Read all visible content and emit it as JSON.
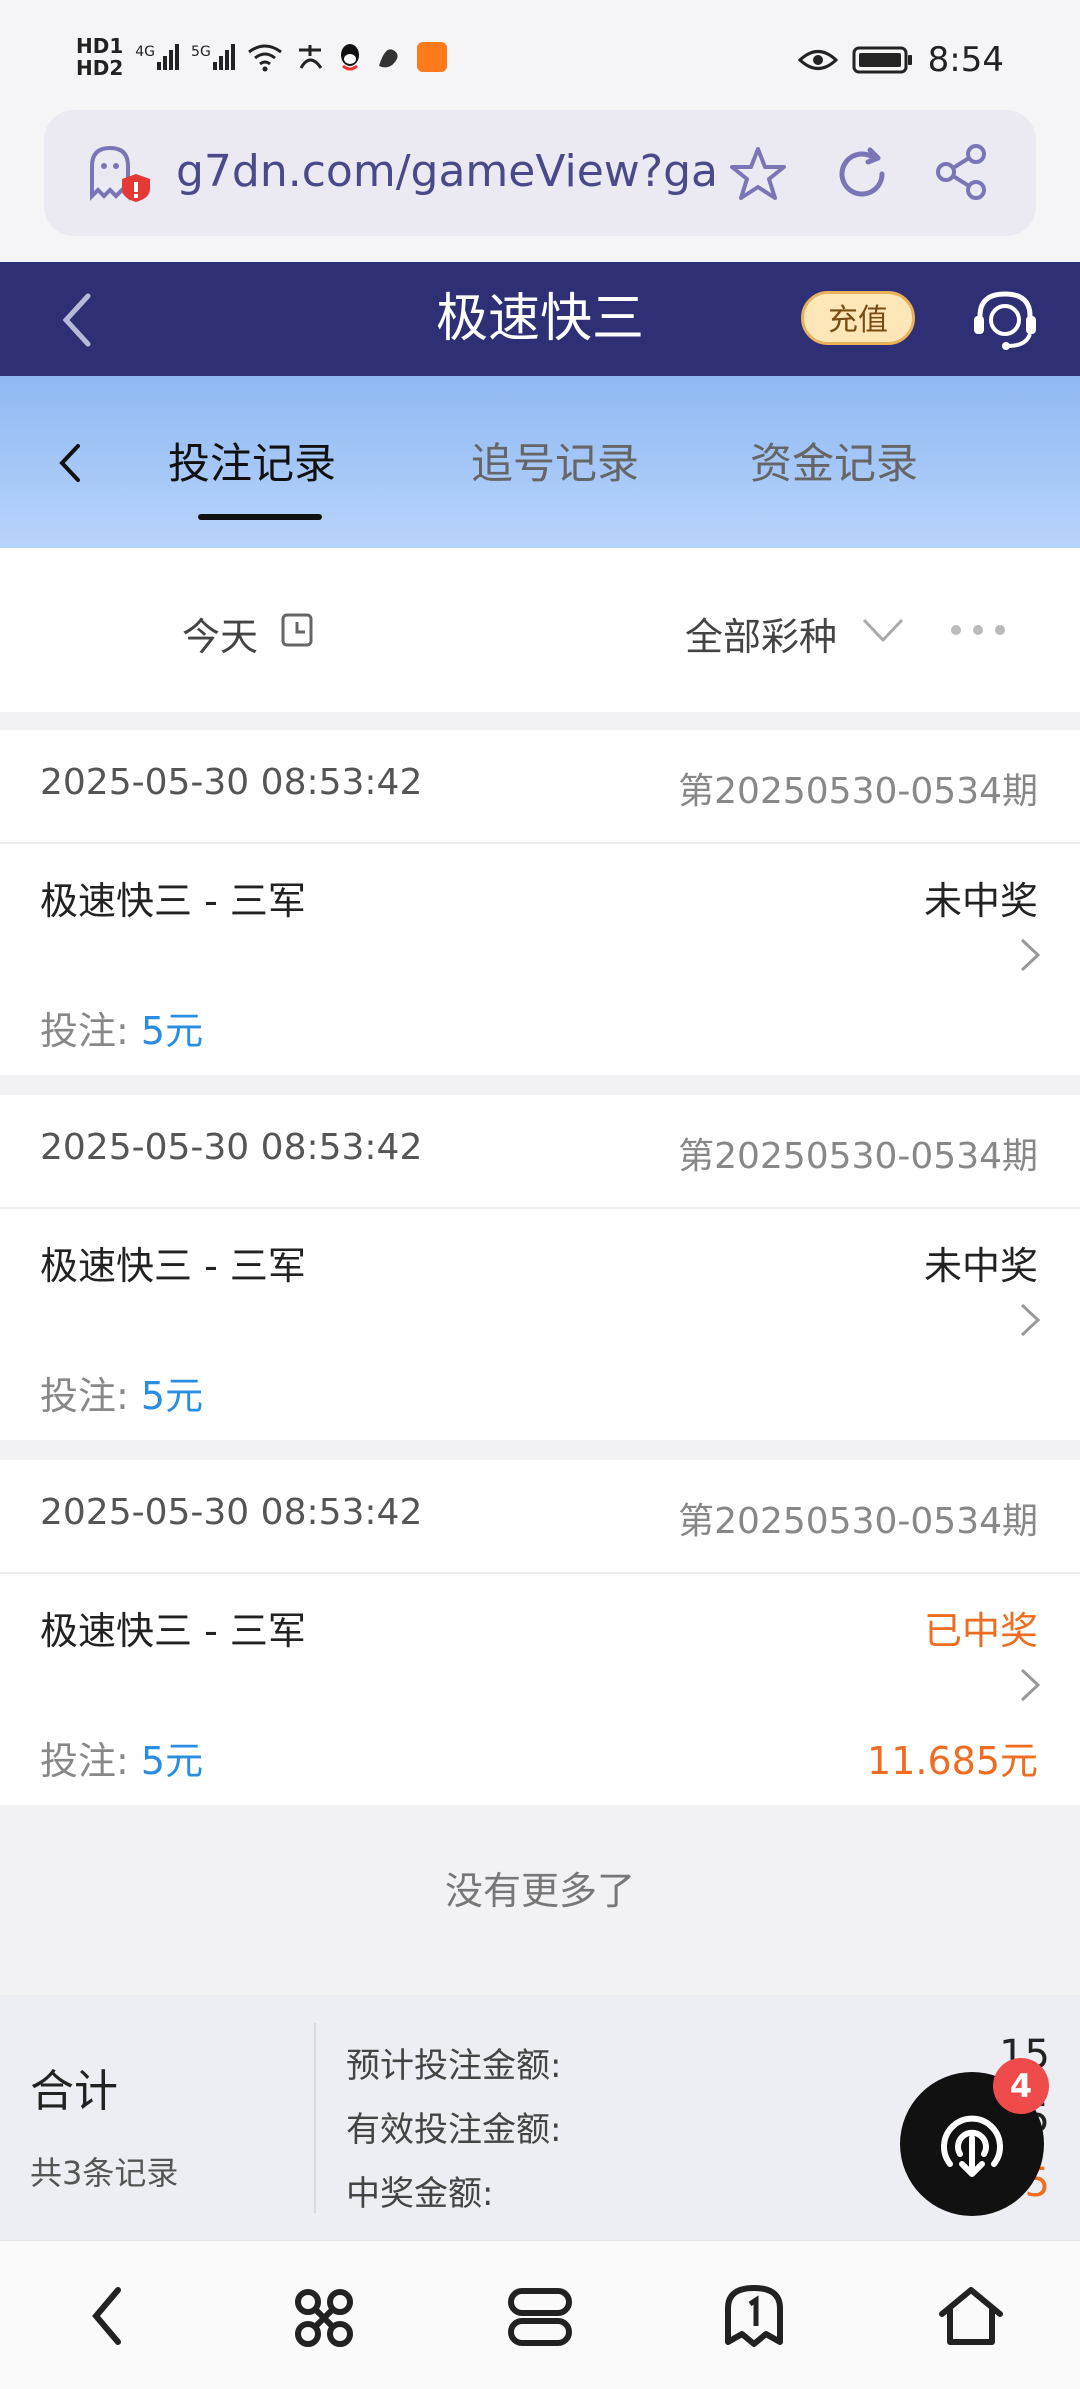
{
  "status_bar": {
    "left_labels": [
      "HD1",
      "HD2",
      "4G",
      "5G"
    ],
    "time": "8:54"
  },
  "browser": {
    "url": "g7dn.com/gameView?ga"
  },
  "header": {
    "title": "极速快三",
    "recharge_label": "充值"
  },
  "tabs": [
    {
      "label": "投注记录",
      "active": true
    },
    {
      "label": "追号记录",
      "active": false
    },
    {
      "label": "资金记录",
      "active": false
    }
  ],
  "filters": {
    "date": "今天",
    "lottery": "全部彩种"
  },
  "records": [
    {
      "time": "2025-05-30 08:53:42",
      "issue": "第20250530-0534期",
      "game": "极速快三 - 三军",
      "status": "未中奖",
      "bet_label": "投注:",
      "bet_value": "5元"
    },
    {
      "time": "2025-05-30 08:53:42",
      "issue": "第20250530-0534期",
      "game": "极速快三 - 三军",
      "status": "未中奖",
      "bet_label": "投注:",
      "bet_value": "5元"
    },
    {
      "time": "2025-05-30 08:53:42",
      "issue": "第20250530-0534期",
      "game": "极速快三 - 三军",
      "status": "已中奖",
      "bet_label": "投注:",
      "bet_value": "5元",
      "win_amount": "11.685元"
    }
  ],
  "no_more": "没有更多了",
  "summary": {
    "title": "合计",
    "count": "共3条记录",
    "expected_label": "预计投注金额:",
    "expected_value": "15",
    "valid_label": "有效投注金额:",
    "valid_value": "5",
    "prize_label": "中奖金额:",
    "prize_value": "5"
  },
  "fab_badge": "4",
  "colors": {
    "header_bg": "#2e2f75",
    "win": "#ef6d21",
    "bet": "#2a8de0",
    "badge": "#ef4b4b"
  }
}
